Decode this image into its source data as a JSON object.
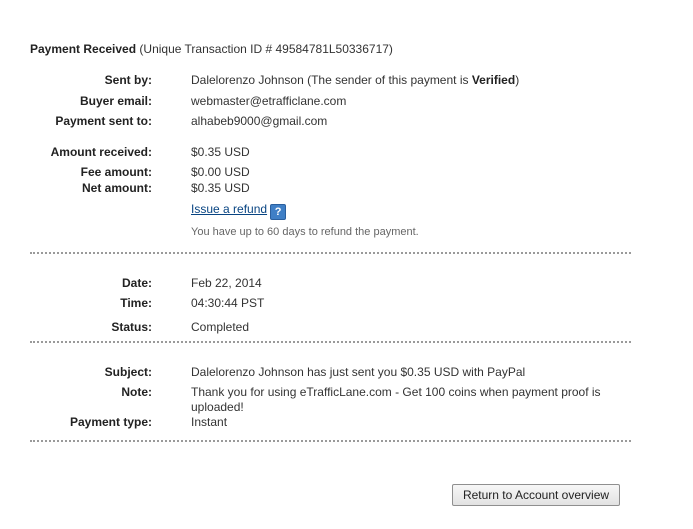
{
  "header": {
    "title": "Payment Received",
    "transaction": "(Unique Transaction ID # 49584781L50336717)"
  },
  "sender": {
    "label": "Sent by:",
    "name": "Dalelorenzo Johnson",
    "status_prefix": " (The sender of this payment is ",
    "status": "Verified",
    "status_suffix": ")"
  },
  "buyer_email": {
    "label": "Buyer email:",
    "value": "webmaster@etrafficlane.com"
  },
  "payment_sent_to": {
    "label": "Payment sent to:",
    "value": "alhabeb9000@gmail.com"
  },
  "amounts": {
    "received": {
      "label": "Amount received:",
      "value": "$0.35 USD"
    },
    "fee": {
      "label": "Fee amount:",
      "value": "$0.00 USD"
    },
    "net": {
      "label": "Net amount:",
      "value": "$0.35 USD"
    }
  },
  "refund": {
    "link": "Issue a refund",
    "help_icon": "?",
    "note": "You have up to 60 days to refund the payment."
  },
  "details": {
    "date": {
      "label": "Date:",
      "value": "Feb 22, 2014"
    },
    "time": {
      "label": "Time:",
      "value": "04:30:44 PST"
    },
    "status": {
      "label": "Status:",
      "value": "Completed"
    }
  },
  "message": {
    "subject": {
      "label": "Subject:",
      "value": "Dalelorenzo Johnson has just sent you $0.35 USD with PayPal"
    },
    "note": {
      "label": "Note:",
      "value": "Thank you for using eTrafficLane.com - Get 100 coins when payment proof is uploaded!"
    },
    "payment_type": {
      "label": "Payment type:",
      "value": "Instant"
    }
  },
  "actions": {
    "return_button": "Return to Account overview"
  }
}
